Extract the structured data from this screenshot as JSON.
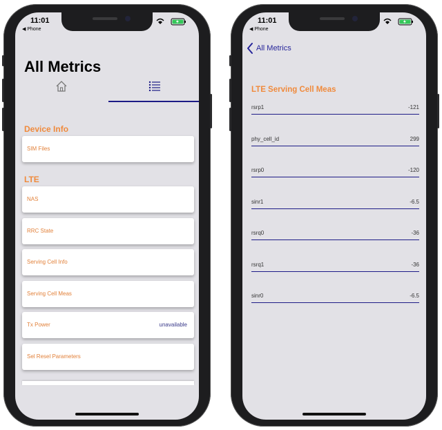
{
  "status_bar": {
    "time": "11:01",
    "back_label": "◀ Phone"
  },
  "left_screen": {
    "title": "All Metrics",
    "tabs": [
      {
        "icon": "home-icon"
      },
      {
        "icon": "list-icon"
      }
    ],
    "sections": [
      {
        "title": "Device Info",
        "items": [
          {
            "label": "SIM Files",
            "value": ""
          }
        ]
      },
      {
        "title": "LTE",
        "items": [
          {
            "label": "NAS",
            "value": ""
          },
          {
            "label": "RRC State",
            "value": ""
          },
          {
            "label": "Serving Cell Info",
            "value": ""
          },
          {
            "label": "Serving Cell Meas",
            "value": ""
          },
          {
            "label": "Tx Power",
            "value": "unavailable"
          },
          {
            "label": "Sel Resel Parameters",
            "value": ""
          }
        ]
      }
    ]
  },
  "right_screen": {
    "back_label": "All Metrics",
    "title": "LTE Serving Cell Meas",
    "rows": [
      {
        "key": "rsrp1",
        "value": "-121"
      },
      {
        "key": "phy_cell_id",
        "value": "299"
      },
      {
        "key": "rsrp0",
        "value": "-120"
      },
      {
        "key": "sinr1",
        "value": "-6.5"
      },
      {
        "key": "rsrq0",
        "value": "-36"
      },
      {
        "key": "rsrq1",
        "value": "-36"
      },
      {
        "key": "sinr0",
        "value": "-6.5"
      }
    ]
  },
  "colors": {
    "accent_orange": "#f08a3c",
    "accent_blue": "#1c1a86",
    "screen_bg": "#e2e1e6"
  }
}
